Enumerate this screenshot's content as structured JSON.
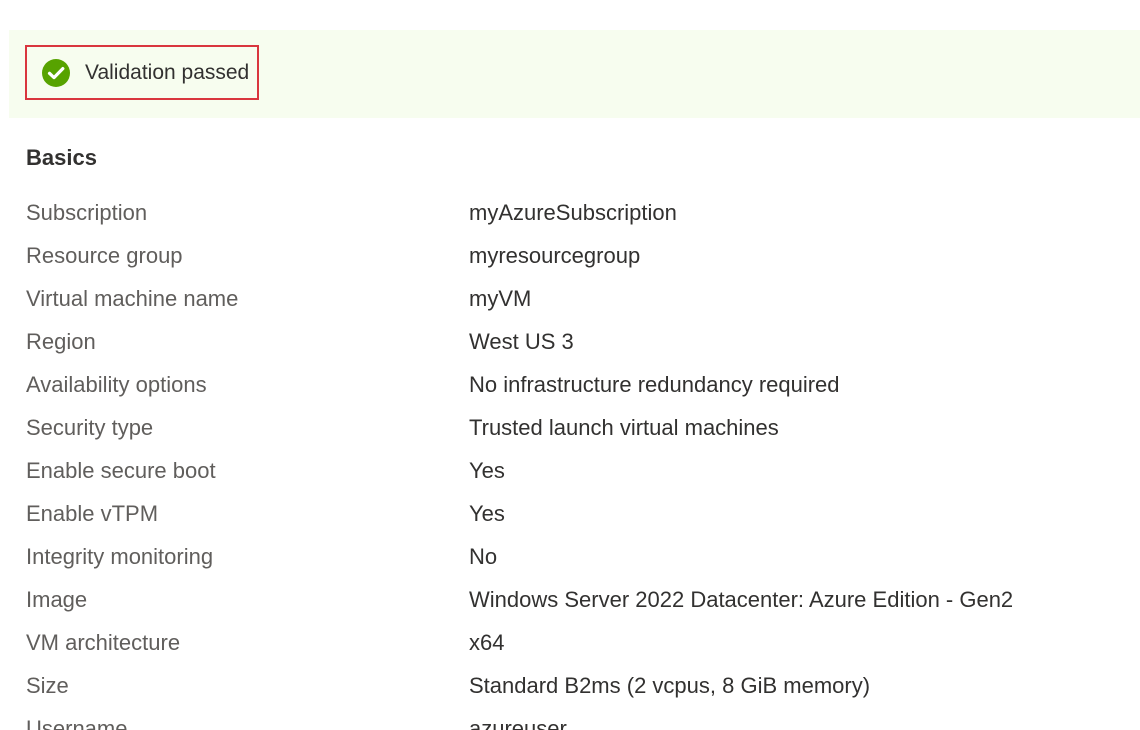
{
  "validation": {
    "status_text": "Validation passed",
    "icon": "check-circle-icon",
    "icon_color": "#57a300",
    "border_color": "#d9363e",
    "banner_color": "#f7fdef"
  },
  "section": {
    "title": "Basics"
  },
  "rows": [
    {
      "label": "Subscription",
      "value": "myAzureSubscription"
    },
    {
      "label": "Resource group",
      "value": "myresourcegroup"
    },
    {
      "label": "Virtual machine name",
      "value": "myVM"
    },
    {
      "label": "Region",
      "value": "West US 3"
    },
    {
      "label": "Availability options",
      "value": "No infrastructure redundancy required"
    },
    {
      "label": "Security type",
      "value": "Trusted launch virtual machines"
    },
    {
      "label": "Enable secure boot",
      "value": "Yes"
    },
    {
      "label": "Enable vTPM",
      "value": "Yes"
    },
    {
      "label": "Integrity monitoring",
      "value": "No"
    },
    {
      "label": "Image",
      "value": "Windows Server 2022 Datacenter: Azure Edition - Gen2"
    },
    {
      "label": "VM architecture",
      "value": "x64"
    },
    {
      "label": "Size",
      "value": "Standard B2ms (2 vcpus, 8 GiB memory)"
    },
    {
      "label": "Username",
      "value": "azureuser"
    }
  ]
}
